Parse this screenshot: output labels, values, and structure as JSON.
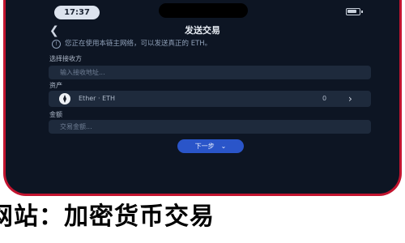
{
  "status_bar": {
    "time": "17:37"
  },
  "nav": {
    "back_icon": "chevron-left",
    "title": "发送交易"
  },
  "notice": {
    "icon": "warning-circle",
    "text": "您正在使用本链主网络，可以发送真正的 ETH。"
  },
  "recipient": {
    "label": "选择接收方",
    "placeholder": "输入接收地址..."
  },
  "asset": {
    "label": "资产",
    "icon": "eth-icon",
    "name": "Ether · ETH",
    "balance": "0"
  },
  "amount": {
    "label": "金额",
    "placeholder": "交易金额..."
  },
  "send_button": {
    "label": "下一步"
  },
  "page_banner": {
    "text": "网站：加密货币交易"
  },
  "colors": {
    "phone_border": "#c2142f",
    "screen_background": "#0d1523",
    "field_background": "#1e2a3c",
    "accent": "#2a55c9"
  }
}
